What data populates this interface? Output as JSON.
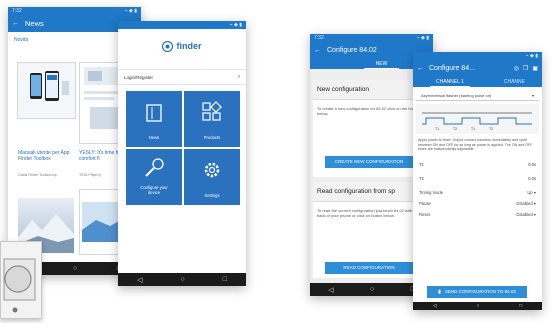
{
  "phone_news": {
    "status_time": "7:32",
    "status_icons": "⌁ ◆ ▮",
    "title": "News",
    "section": "Novità",
    "item1_title": "Manuali utente per App Finder Toolbox",
    "item1_meta": "Guida Finder Toolbox.zip",
    "item2_title": "YESLY: It's time for comfort fi",
    "item2_meta": "YESLY flyer.fy"
  },
  "phone_menu": {
    "status_icons": "⌁ ◆ ▮",
    "logo_text": "finder",
    "login_label": "Login/Register",
    "login_chevron": "›",
    "tiles": [
      "News",
      "Products",
      "Configure your device",
      "Settings"
    ]
  },
  "phone_configure": {
    "status_time": "7:32",
    "status_icons": "⌁ ◆ ▮",
    "title": "Configure 84.02",
    "tab": "NEW",
    "new_heading": "New configuration",
    "new_text": "To create a new configuration for 84.02 click on the button below.",
    "new_button": "CREATE NEW CONFIGURATION",
    "read_heading": "Read configuration from sp",
    "read_text": "To read the current configuration just touch 84.02 with the back of your phone or click on button below.",
    "read_button": "READ CONFIGURATION"
  },
  "phone_channel": {
    "status_icons": "⌁ ◆ ▮",
    "title": "Configure 84...",
    "tab_active": "CHANNEL 1",
    "tab_next": "CHANNE",
    "mode_label": "Asymmetrical flasher (starting pulse on)",
    "timing_labels": [
      "T1",
      "T2",
      "T1",
      "T2"
    ],
    "description": "Apply power to timer. Output contact transfers immediately and cycle between ON and OFF for as long as power is applied. The ON and OFF times are independently adjustable.",
    "rows": [
      {
        "label": "T1",
        "value": "0.0s"
      },
      {
        "label": "T2",
        "value": "0.0s"
      },
      {
        "label": "Timing mode",
        "value": "Up"
      },
      {
        "label": "Pause",
        "value": "Disabled"
      },
      {
        "label": "Reset",
        "value": "Disabled"
      }
    ],
    "send_button": "SEND CONFIGURATION TO 84.02"
  },
  "nav_glyphs": [
    "◁",
    "○",
    "□"
  ],
  "colors": {
    "appbar": "#1f78c8",
    "tile": "#2a72bd",
    "button": "#2e8fd8",
    "accent_light": "#3f97dc"
  }
}
